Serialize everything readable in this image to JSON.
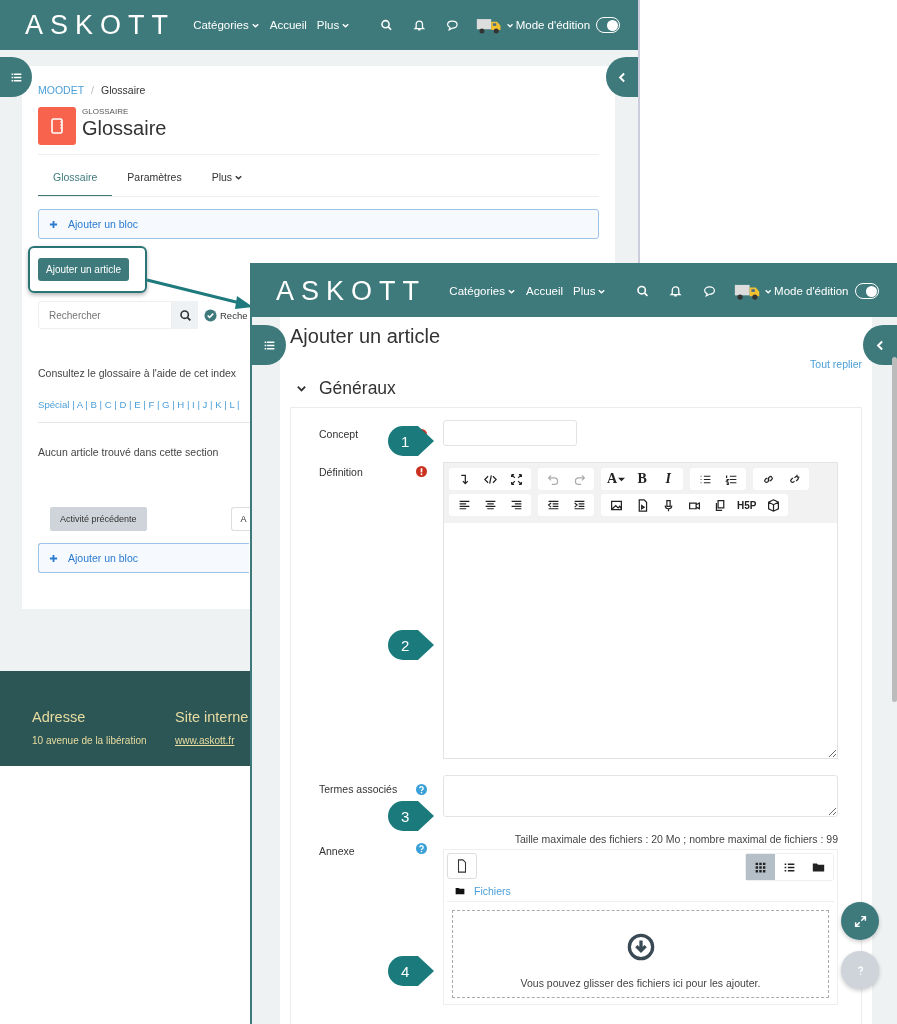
{
  "back_page": {
    "navbar": {
      "logo": "ASKOTT",
      "menu": [
        {
          "label": "Catégories",
          "dropdown": true
        },
        {
          "label": "Accueil",
          "dropdown": false
        },
        {
          "label": "Plus",
          "dropdown": true
        }
      ],
      "edit_mode": {
        "label": "Mode d'édition",
        "on": true
      }
    },
    "breadcrumb": [
      "MOODET",
      "Glossaire"
    ],
    "breadcrumb_separator": "/",
    "activity_type": "GLOSSAIRE",
    "title": "Glossaire",
    "tabs": [
      {
        "label": "Glossaire",
        "selected": true,
        "dropdown": false
      },
      {
        "label": "Paramètres",
        "selected": false,
        "dropdown": false
      },
      {
        "label": "Plus",
        "selected": false,
        "dropdown": true
      }
    ],
    "add_block_top": "Ajouter un bloc",
    "add_article_button": "Ajouter un article",
    "search": {
      "placeholder": "Rechercher"
    },
    "search_option": {
      "label": "Reche",
      "checked": true
    },
    "index_heading": "Consultez le glossaire à l'aide de cet index",
    "index": "Spécial | A | B | C | D | E | F | G | H | I | J | K | L |",
    "empty_message": "Aucun article trouvé dans cette section",
    "previous_button": "Activité précédente",
    "next_button": "A",
    "add_block_bottom": "Ajouter un bloc",
    "footer": [
      {
        "heading": "Adresse",
        "text": "10 avenue de la libération",
        "kind": "text"
      },
      {
        "heading": "Site interne",
        "text": "www.askott.fr",
        "kind": "link"
      }
    ]
  },
  "front_page": {
    "navbar": {
      "logo": "ASKOTT",
      "menu": [
        {
          "label": "Catégories",
          "dropdown": true
        },
        {
          "label": "Accueil",
          "dropdown": false
        },
        {
          "label": "Plus",
          "dropdown": true
        }
      ],
      "edit_mode": {
        "label": "Mode d'édition",
        "on": true
      }
    },
    "title": "Ajouter un article",
    "collapse_all": "Tout replier",
    "section": {
      "title": "Généraux",
      "expanded": true
    },
    "fields": [
      {
        "label": "Concept",
        "required": true,
        "help": false,
        "kind": "input"
      },
      {
        "label": "Définition",
        "required": true,
        "help": false,
        "kind": "editor"
      },
      {
        "label": "Termes associés",
        "required": false,
        "help": true,
        "kind": "textarea"
      },
      {
        "label": "Annexe",
        "required": false,
        "help": true,
        "kind": "files"
      }
    ],
    "editor_toolbar": [
      [
        [
          {
            "kind": "insert",
            "disabled": false
          },
          {
            "kind": "html",
            "disabled": false
          },
          {
            "kind": "fullscreen",
            "disabled": false
          }
        ],
        [
          {
            "kind": "undo",
            "disabled": true
          },
          {
            "kind": "redo",
            "disabled": true
          }
        ],
        [
          {
            "kind": "fontcolor",
            "label": "A",
            "disabled": false
          },
          {
            "kind": "bold",
            "label": "B",
            "disabled": false
          },
          {
            "kind": "italic",
            "label": "I",
            "disabled": false
          }
        ],
        [
          {
            "kind": "ul",
            "disabled": false
          },
          {
            "kind": "ol",
            "disabled": false
          }
        ],
        [
          {
            "kind": "link",
            "disabled": false
          },
          {
            "kind": "unlink",
            "disabled": false
          }
        ]
      ],
      [
        [
          {
            "kind": "align-left",
            "disabled": false
          },
          {
            "kind": "align-center",
            "disabled": false
          },
          {
            "kind": "align-right",
            "disabled": false
          }
        ],
        [
          {
            "kind": "outdent",
            "disabled": false
          },
          {
            "kind": "indent",
            "disabled": false
          }
        ],
        [
          {
            "kind": "image",
            "disabled": false
          },
          {
            "kind": "media",
            "disabled": false
          },
          {
            "kind": "audio",
            "disabled": false
          },
          {
            "kind": "video",
            "disabled": false
          },
          {
            "kind": "files",
            "disabled": false
          },
          {
            "kind": "h5p",
            "label": "H5P",
            "disabled": false
          },
          {
            "kind": "block",
            "disabled": false
          }
        ]
      ]
    ],
    "file_limits": "Taille maximale des fichiers : 20 Mo ; nombre maximal de fichiers : 99",
    "file_views": [
      {
        "kind": "grid",
        "selected": true
      },
      {
        "kind": "list",
        "selected": false
      },
      {
        "kind": "tree",
        "selected": false
      }
    ],
    "file_path": "Fichiers",
    "dropzone_text": "Vous pouvez glisser des fichiers ici pour les ajouter."
  },
  "callouts": [
    "1",
    "2",
    "3",
    "4"
  ]
}
